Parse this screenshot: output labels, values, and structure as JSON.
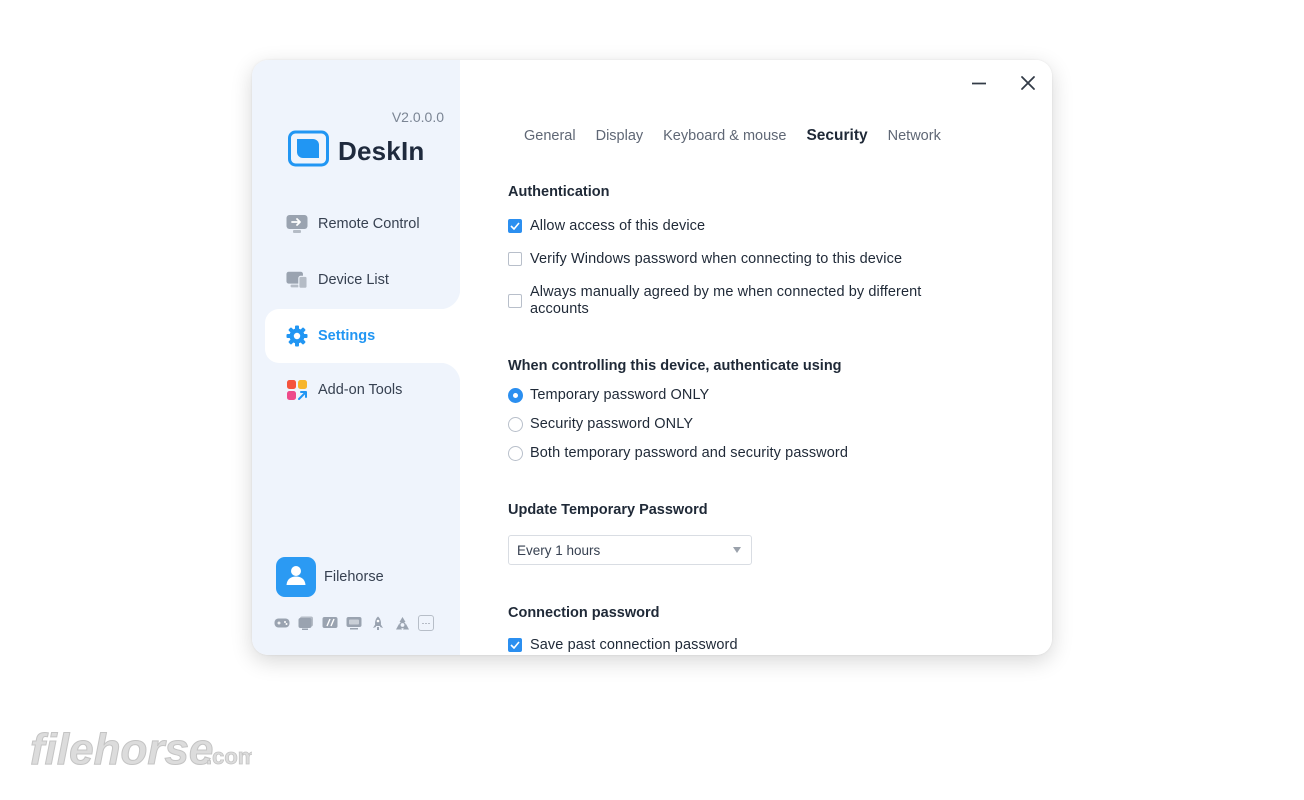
{
  "app": {
    "name": "DeskIn",
    "version": "V2.0.0.0",
    "accent_color": "#2196f3"
  },
  "sidebar": {
    "items": [
      {
        "label": "Remote Control",
        "icon": "remote-control-icon"
      },
      {
        "label": "Device List",
        "icon": "device-list-icon"
      },
      {
        "label": "Settings",
        "icon": "settings-gear-icon",
        "active": true
      },
      {
        "label": "Add-on Tools",
        "icon": "add-on-tools-icon"
      }
    ],
    "user": {
      "name": "Filehorse",
      "icon": "avatar-icon"
    },
    "tool_icons": [
      "gamepad-icon",
      "display-icon",
      "edit-display-icon",
      "monitor-icon",
      "rocket-icon",
      "recycle-icon",
      "more-icon"
    ]
  },
  "window_controls": {
    "minimize": "minimize-icon",
    "close": "close-icon"
  },
  "tabs": [
    {
      "label": "General"
    },
    {
      "label": "Display"
    },
    {
      "label": "Keyboard & mouse"
    },
    {
      "label": "Security",
      "active": true
    },
    {
      "label": "Network"
    }
  ],
  "security": {
    "authentication": {
      "title": "Authentication",
      "options": [
        {
          "label": "Allow access of this device",
          "checked": true
        },
        {
          "label": "Verify Windows password when connecting to this device",
          "checked": false
        },
        {
          "label": "Always manually agreed by me when connected by different accounts",
          "checked": false
        }
      ]
    },
    "auth_method": {
      "title": "When controlling this device, authenticate using",
      "options": [
        {
          "label": "Temporary password ONLY",
          "selected": true
        },
        {
          "label": "Security password ONLY",
          "selected": false
        },
        {
          "label": "Both temporary password and security password",
          "selected": false
        }
      ]
    },
    "update_temp_password": {
      "title": "Update Temporary Password",
      "value": "Every 1 hours"
    },
    "connection_password": {
      "title": "Connection password",
      "options": [
        {
          "label": "Save past connection password",
          "checked": true
        }
      ]
    }
  },
  "watermark": {
    "text": "filehorse",
    "suffix": ".com"
  }
}
